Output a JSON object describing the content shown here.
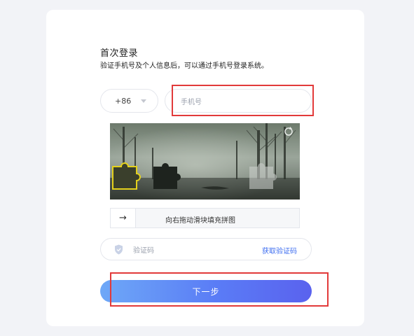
{
  "form": {
    "title": "首次登录",
    "subtitle": "验证手机号及个人信息后，可以通过手机号登录系统。",
    "country_code": "+86",
    "phone_placeholder": "手机号",
    "slider_hint": "向右拖动滑块填充拼图",
    "slider_arrow": "→",
    "code_placeholder": "验证码",
    "get_code_label": "获取验证码",
    "next_label": "下一步"
  },
  "icons": {
    "refresh": "refresh-icon",
    "shield": "shield-icon",
    "chevron": "chevron-down-icon",
    "arrow": "arrow-right-icon"
  },
  "colors": {
    "accent": "#3d6df0",
    "button_start": "#6ea8f7",
    "button_end": "#5a62ee",
    "highlight": "#e23a3a",
    "puzzle_outline": "#e4d11c"
  }
}
